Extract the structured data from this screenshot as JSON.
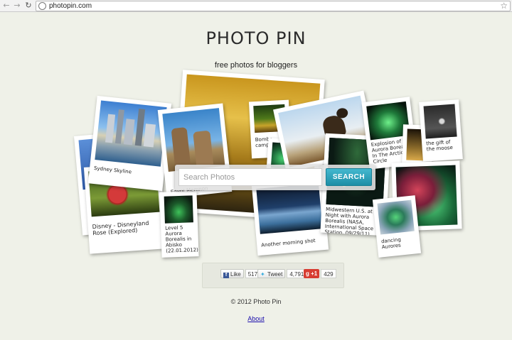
{
  "browser": {
    "url": "photopin.com"
  },
  "header": {
    "title": "PHOTO PIN",
    "tagline": "free photos for bloggers"
  },
  "photos": [
    {
      "caption": "Sydney Skyline"
    },
    {
      "caption": "Disney - Disneyland Rose (Explored)"
    },
    {
      "caption": "Egypt Memnon"
    },
    {
      "caption": "Level 5 Aurora Borealis in Abisko (22.01.2012)"
    },
    {
      "caption": "Bombe camp"
    },
    {
      "caption": "Another morning shot"
    },
    {
      "caption": "Midwestern U.S. at Night with Aurora Borealis (NASA, International Space Station, 09/29/11)"
    },
    {
      "caption": "Explosion of Aurora Borealis In The Arctic Circle"
    },
    {
      "caption": "the gift of the moose"
    },
    {
      "caption": "dancing Aurores"
    }
  ],
  "search": {
    "placeholder": "Search Photos",
    "button_label": "SEARCH"
  },
  "social": {
    "facebook": {
      "label": "Like",
      "count": "517"
    },
    "twitter": {
      "label": "Tweet",
      "count": "4,791"
    },
    "gplus": {
      "label": "+1",
      "count": "429"
    }
  },
  "footer": {
    "copyright": "© 2012 Photo Pin",
    "about_label": "About"
  },
  "colors": {
    "background": "#eff1e8",
    "search_button": "#1e8ea6",
    "link": "#1a0dab"
  }
}
